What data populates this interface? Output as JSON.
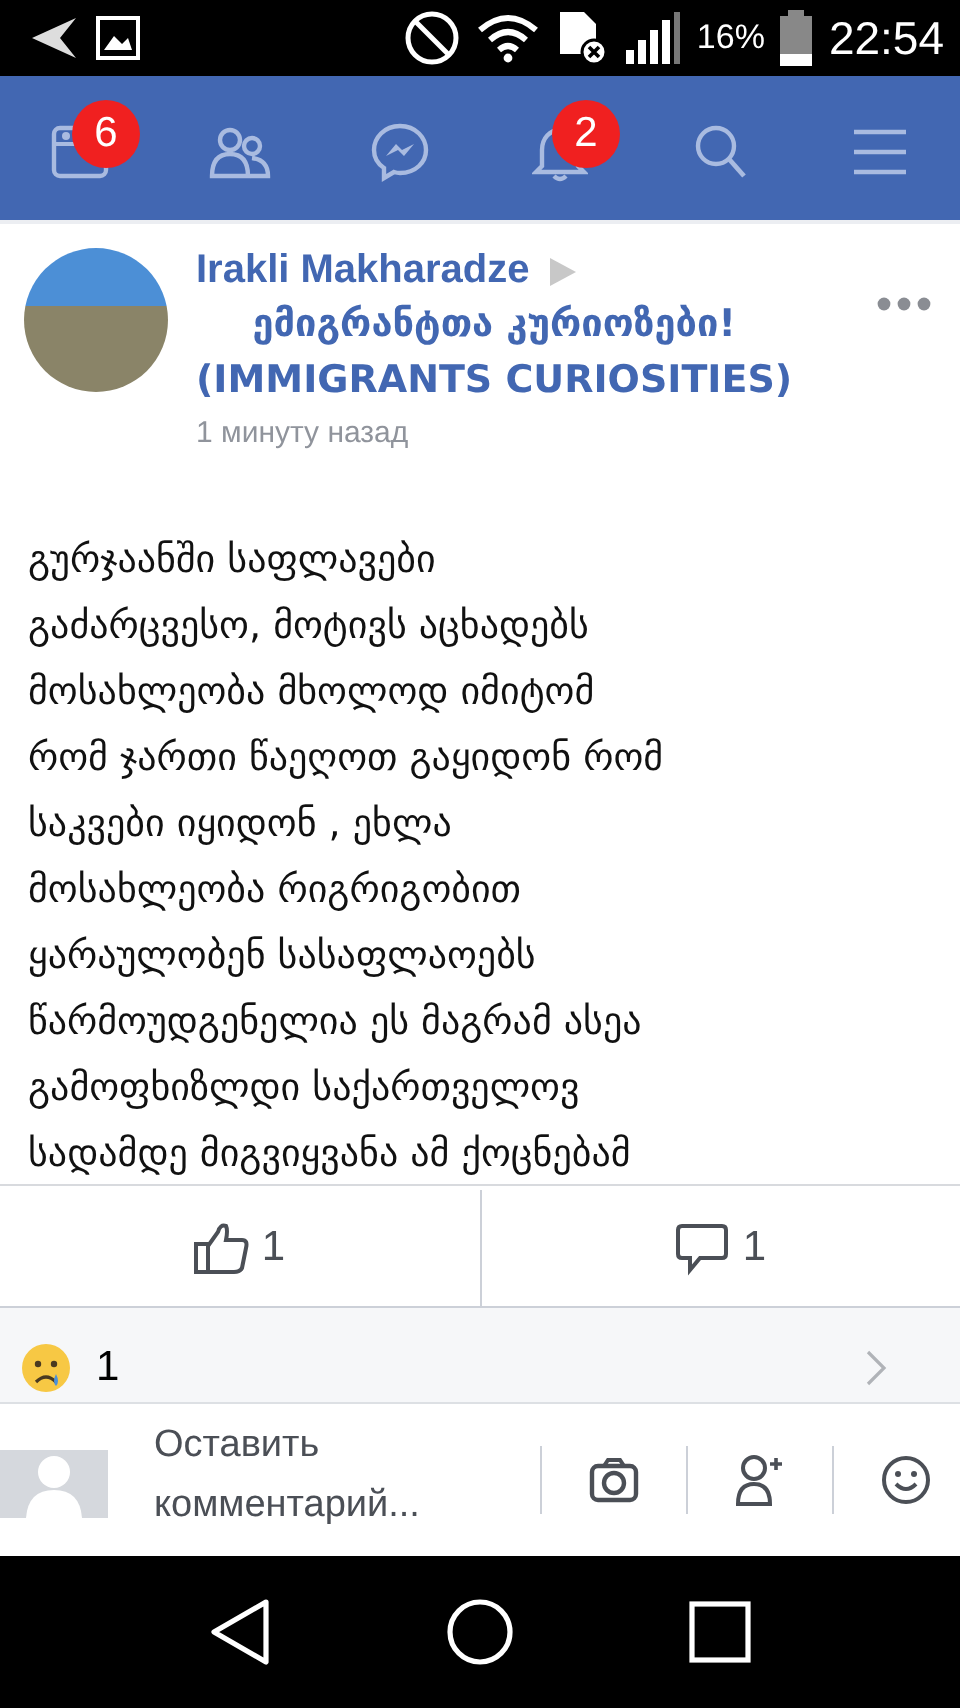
{
  "status_bar": {
    "battery": "16%",
    "time": "22:54"
  },
  "nav_tabs": [
    {
      "kind": "feed",
      "badge": "6"
    },
    {
      "kind": "friends"
    },
    {
      "kind": "messenger"
    },
    {
      "kind": "notifications",
      "badge": "2"
    },
    {
      "kind": "search"
    },
    {
      "kind": "menu"
    }
  ],
  "post": {
    "author": "Irakli Makharadze",
    "page": "ემიგრანტთა კურიოზები!\n(IMMIGRANTS CURIOSITIES)",
    "time": "1 минуту назад",
    "text": "გურჯაანში საფლავები\nგაძარცვესო, მოტივს აცხადებს\nმოსახლეობა მხოლოდ იმიტომ\nრომ ჯართი წაეღოთ გაყიდონ რომ\nსაკვები იყიდონ , ეხლა\nმოსახლეობა რიგრიგობით\nყარაულობენ სასაფლაოებს\nწარმოუდგენელია ეს მაგრამ ასეა\nგამოფხიზლდი საქართველოვ\nსადამდე მიგვიყვანა ამ ქოცნებამ",
    "likes": "1",
    "comments": "1",
    "reaction_count": "1"
  },
  "comment_bar": {
    "placeholder": "Оставить комментарий..."
  }
}
